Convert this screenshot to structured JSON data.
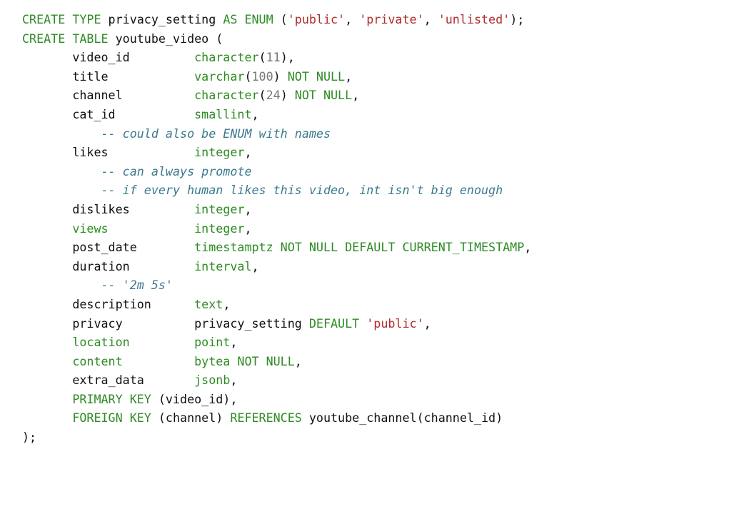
{
  "document": {
    "language": "SQL",
    "colors": {
      "keyword": "#2e8b24",
      "string": "#b22b2b",
      "number": "#777777",
      "comment": "#3b7a8f",
      "text": "#111111",
      "background": "#ffffff"
    },
    "lines": [
      [
        [
          "kw",
          "CREATE TYPE"
        ],
        [
          "id",
          " privacy_setting "
        ],
        [
          "kw",
          "AS ENUM"
        ],
        [
          "p",
          " ("
        ],
        [
          "str",
          "'public'"
        ],
        [
          "p",
          ", "
        ],
        [
          "str",
          "'private'"
        ],
        [
          "p",
          ", "
        ],
        [
          "str",
          "'unlisted'"
        ],
        [
          "p",
          ");"
        ]
      ],
      [
        [
          "kw",
          "CREATE TABLE"
        ],
        [
          "id",
          " youtube_video ("
        ]
      ],
      [
        [
          "id",
          "       video_id         "
        ],
        [
          "kw",
          "character"
        ],
        [
          "p",
          "("
        ],
        [
          "num",
          "11"
        ],
        [
          "p",
          "),"
        ]
      ],
      [
        [
          "id",
          "       title            "
        ],
        [
          "kw",
          "varchar"
        ],
        [
          "p",
          "("
        ],
        [
          "num",
          "100"
        ],
        [
          "p",
          ") "
        ],
        [
          "kw",
          "NOT NULL"
        ],
        [
          "p",
          ","
        ]
      ],
      [
        [
          "id",
          "       channel          "
        ],
        [
          "kw",
          "character"
        ],
        [
          "p",
          "("
        ],
        [
          "num",
          "24"
        ],
        [
          "p",
          ") "
        ],
        [
          "kw",
          "NOT NULL"
        ],
        [
          "p",
          ","
        ]
      ],
      [
        [
          "id",
          "       cat_id           "
        ],
        [
          "kw",
          "smallint"
        ],
        [
          "p",
          ","
        ]
      ],
      [
        [
          "cm",
          "           -- could also be ENUM with names"
        ]
      ],
      [
        [
          "id",
          "       likes            "
        ],
        [
          "kw",
          "integer"
        ],
        [
          "p",
          ","
        ]
      ],
      [
        [
          "cm",
          "           -- can always promote"
        ]
      ],
      [
        [
          "cm",
          "           -- if every human likes this video, int isn't big enough"
        ]
      ],
      [
        [
          "id",
          "       dislikes         "
        ],
        [
          "kw",
          "integer"
        ],
        [
          "p",
          ","
        ]
      ],
      [
        [
          "kw",
          "       views            "
        ],
        [
          "kw",
          "integer"
        ],
        [
          "p",
          ","
        ]
      ],
      [
        [
          "id",
          "       post_date        "
        ],
        [
          "kw",
          "timestamptz NOT NULL DEFAULT CURRENT_TIMESTAMP"
        ],
        [
          "p",
          ","
        ]
      ],
      [
        [
          "id",
          "       duration         "
        ],
        [
          "kw",
          "interval"
        ],
        [
          "p",
          ","
        ]
      ],
      [
        [
          "cm",
          "           -- '2m 5s'"
        ]
      ],
      [
        [
          "id",
          "       description      "
        ],
        [
          "kw",
          "text"
        ],
        [
          "p",
          ","
        ]
      ],
      [
        [
          "id",
          "       privacy          "
        ],
        [
          "id",
          "privacy_setting "
        ],
        [
          "kw",
          "DEFAULT"
        ],
        [
          "p",
          " "
        ],
        [
          "str",
          "'public'"
        ],
        [
          "p",
          ","
        ]
      ],
      [
        [
          "kw",
          "       location         "
        ],
        [
          "kw",
          "point"
        ],
        [
          "p",
          ","
        ]
      ],
      [
        [
          "kw",
          "       content          "
        ],
        [
          "kw",
          "bytea"
        ],
        [
          "p",
          " "
        ],
        [
          "kw",
          "NOT NULL"
        ],
        [
          "p",
          ","
        ]
      ],
      [
        [
          "id",
          "       extra_data       "
        ],
        [
          "kw",
          "jsonb"
        ],
        [
          "p",
          ","
        ]
      ],
      [
        [
          "kw",
          "       PRIMARY KEY"
        ],
        [
          "p",
          " (video_id),"
        ]
      ],
      [
        [
          "kw",
          "       FOREIGN KEY"
        ],
        [
          "p",
          " (channel) "
        ],
        [
          "kw",
          "REFERENCES"
        ],
        [
          "p",
          " youtube_channel(channel_id)"
        ]
      ],
      [
        [
          "p",
          ");"
        ]
      ]
    ]
  }
}
